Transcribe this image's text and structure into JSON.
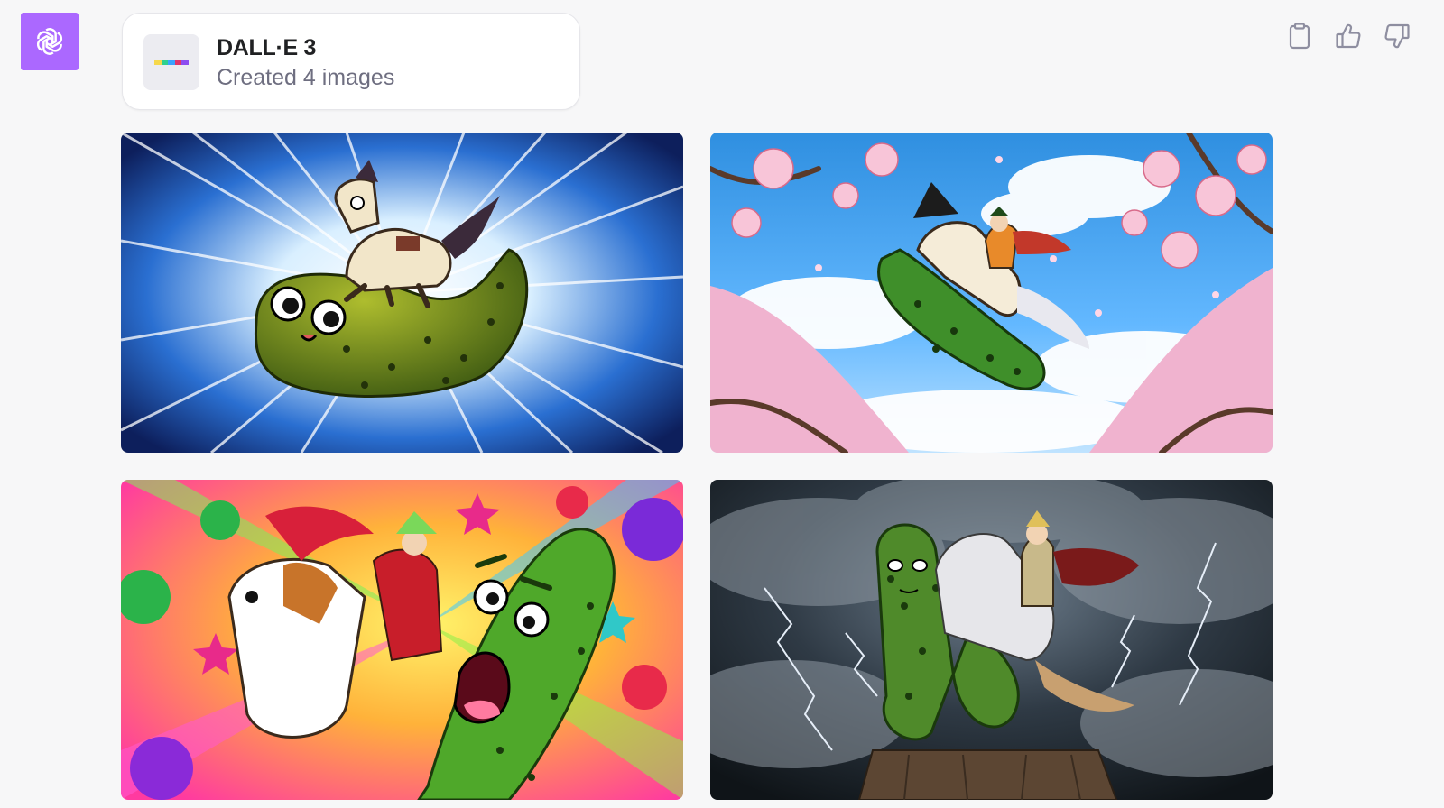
{
  "assistant": {
    "avatar_icon": "openai-logo-icon",
    "avatar_color": "#ab68ff"
  },
  "tool_card": {
    "name": "DALL·E 3",
    "status": "Created 4 images",
    "icon": "dalle-color-strip-icon",
    "strip_colors": [
      "#f6d84c",
      "#2fd08f",
      "#3ba3ff",
      "#e0366b",
      "#8c4cf0"
    ]
  },
  "actions": [
    {
      "name": "copy-icon"
    },
    {
      "name": "thumbs-up-icon"
    },
    {
      "name": "thumbs-down-icon"
    }
  ],
  "images": [
    {
      "name": "image-1",
      "theme": "manga-speedlines"
    },
    {
      "name": "image-2",
      "theme": "cherry-blossom-sky"
    },
    {
      "name": "image-3",
      "theme": "pop-stars"
    },
    {
      "name": "image-4",
      "theme": "storm-lightning"
    }
  ]
}
